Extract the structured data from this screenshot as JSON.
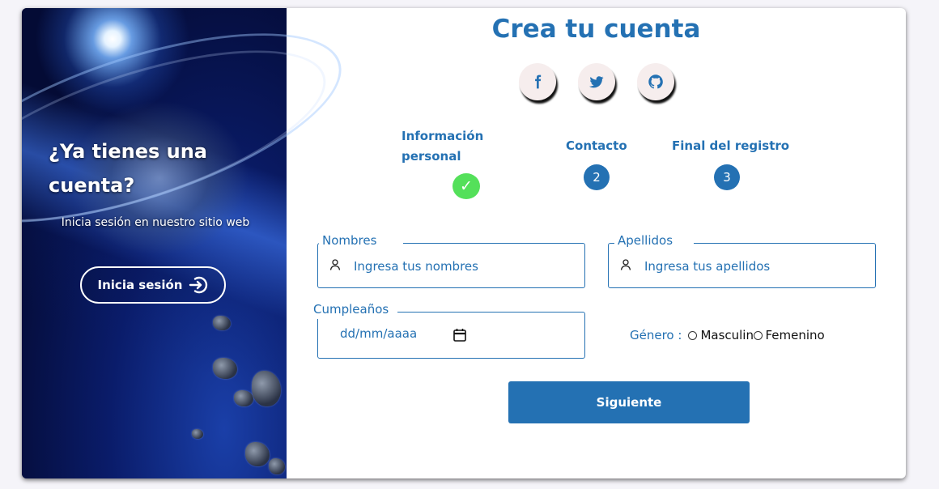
{
  "left": {
    "title": "¿Ya tienes una cuenta?",
    "subtitle": "Inicia sesión en nuestro sitio web",
    "login_button": "Inicia sesión"
  },
  "main": {
    "title": "Crea tu cuenta",
    "social": [
      "facebook-icon",
      "twitter-icon",
      "github-icon"
    ],
    "steps": [
      {
        "label": "Información personal",
        "badge": "✓",
        "status": "done"
      },
      {
        "label": "Contacto",
        "badge": "2",
        "status": "pending"
      },
      {
        "label": "Final del registro",
        "badge": "3",
        "status": "pending"
      }
    ],
    "fields": {
      "nombres": {
        "legend": "Nombres",
        "placeholder": "Ingresa tus nombres"
      },
      "apellidos": {
        "legend": "Apellidos",
        "placeholder": "Ingresa tus apellidos"
      },
      "cumpleanos": {
        "legend": "Cumpleaños",
        "placeholder": "dd/mm/aaaa"
      }
    },
    "gender": {
      "label": "Género :",
      "options": [
        "Masculino",
        "Femenino"
      ]
    },
    "next_button": "Siguiente"
  },
  "colors": {
    "accent": "#2471b3",
    "step_done": "#54e05a",
    "social_bg": "#f6eded"
  }
}
